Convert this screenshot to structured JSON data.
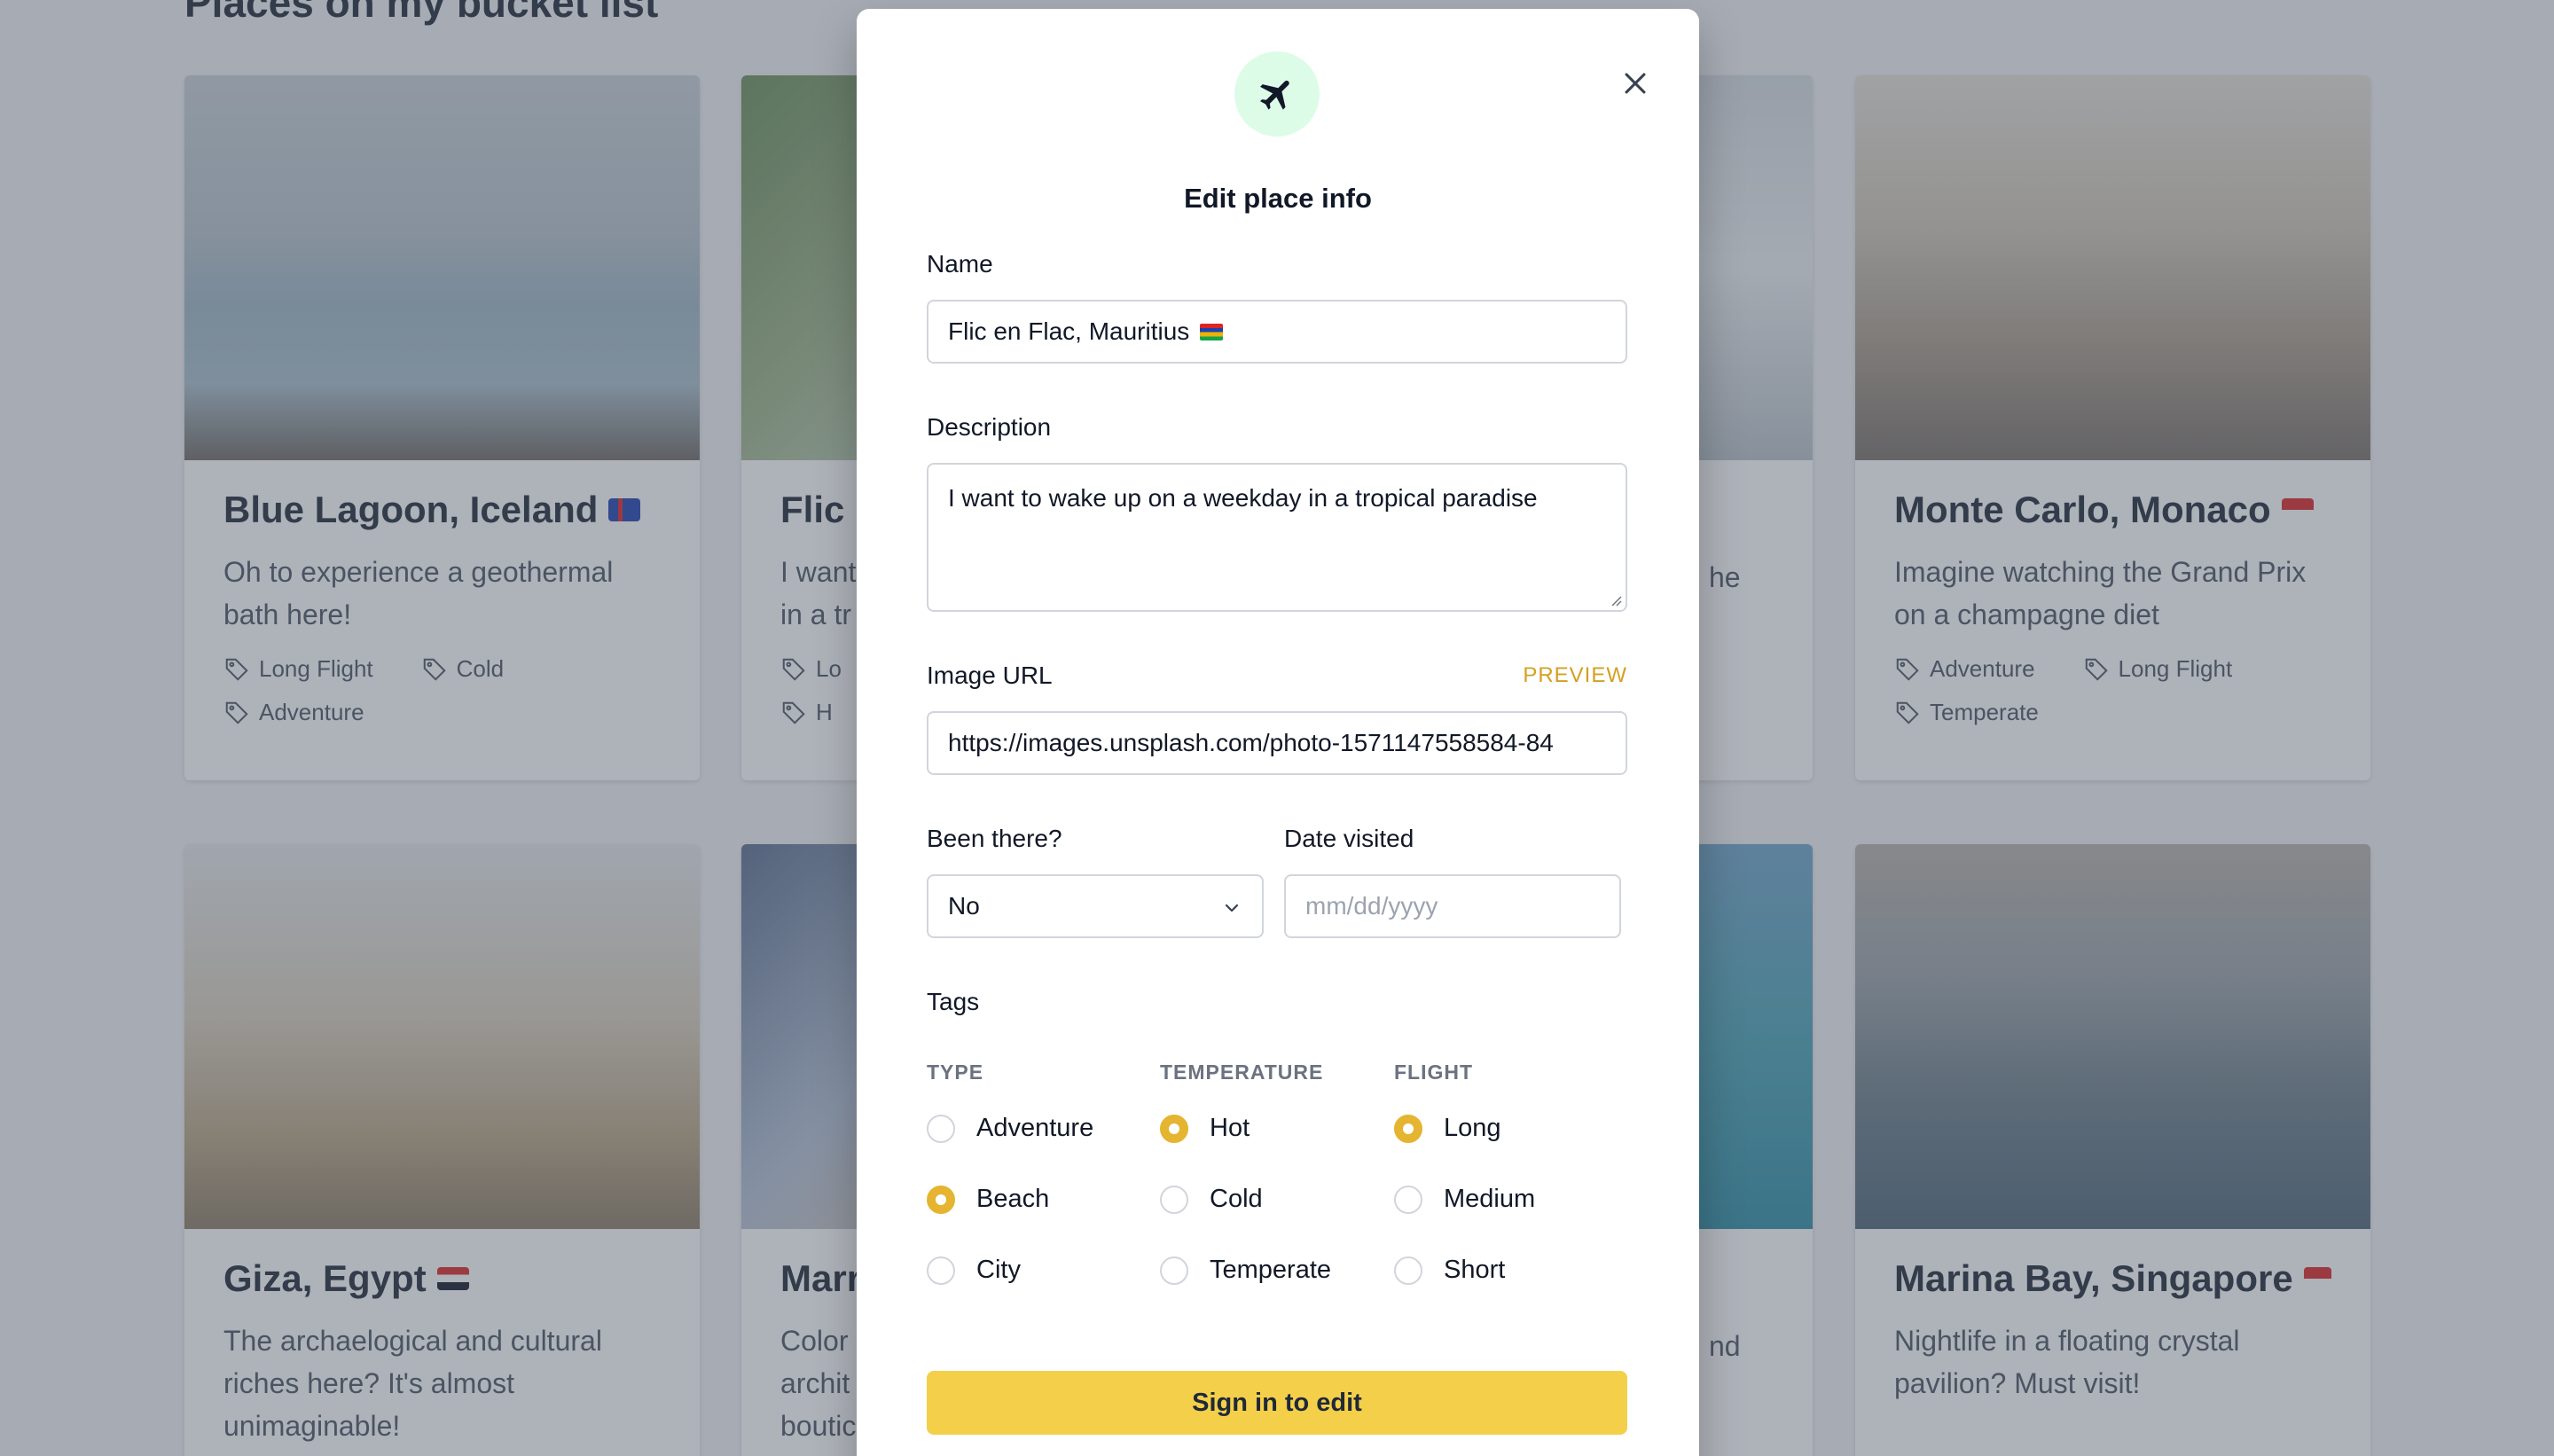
{
  "page": {
    "heading": "Places on my bucket list"
  },
  "cards": [
    {
      "title": "Blue Lagoon, Iceland",
      "description": "Oh to experience a geothermal bath here!",
      "tags": [
        "Long Flight",
        "Cold",
        "Adventure"
      ],
      "flag_colors": [
        "#1e40af",
        "#dc2626"
      ]
    },
    {
      "title": "Flic",
      "description": "I want",
      "description2": "in a tr",
      "tags": [
        "Lo",
        "H"
      ],
      "flag_colors": [
        "#16a34a",
        "#eab308"
      ]
    },
    {
      "title": "",
      "description": "he",
      "tags": [],
      "flag_colors": []
    },
    {
      "title": "Monte Carlo, Monaco",
      "description": "Imagine watching the Grand Prix on a champagne diet",
      "tags": [
        "Adventure",
        "Long Flight",
        "Temperate"
      ],
      "flag_colors": [
        "#dc2626",
        "#ffffff"
      ]
    },
    {
      "title": "Giza, Egypt",
      "description": "The archaelogical and cultural riches here? It's almost unimaginable!",
      "tags": [],
      "flag_colors": [
        "#dc2626",
        "#111827"
      ]
    },
    {
      "title": "Marr",
      "description": "Color",
      "description2": "archit",
      "description3": "boutic",
      "tags": [],
      "flag_colors": []
    },
    {
      "title": "",
      "description": "nd",
      "tags": [],
      "flag_colors": []
    },
    {
      "title": "Marina Bay, Singapore",
      "description": "Nightlife in a floating crystal pavilion? Must visit!",
      "tags": [],
      "flag_colors": [
        "#dc2626",
        "#ffffff"
      ]
    }
  ],
  "modal": {
    "icon": "airplane-icon",
    "title": "Edit place info",
    "close_icon": "close-icon",
    "name": {
      "label": "Name",
      "value": "Flic en Flac, Mauritius"
    },
    "description": {
      "label": "Description",
      "value": "I want to wake up on a weekday in a tropical paradise"
    },
    "image_url": {
      "label": "Image URL",
      "preview": "PREVIEW",
      "value": "https://images.unsplash.com/photo-1571147558584-84"
    },
    "been_there": {
      "label": "Been there?",
      "value": "No"
    },
    "date_visited": {
      "label": "Date visited",
      "placeholder": "mm/dd/yyyy"
    },
    "tags": {
      "label": "Tags",
      "groups": [
        {
          "header": "TYPE",
          "options": [
            {
              "label": "Adventure",
              "selected": false
            },
            {
              "label": "Beach",
              "selected": true
            },
            {
              "label": "City",
              "selected": false
            }
          ]
        },
        {
          "header": "TEMPERATURE",
          "options": [
            {
              "label": "Hot",
              "selected": true
            },
            {
              "label": "Cold",
              "selected": false
            },
            {
              "label": "Temperate",
              "selected": false
            }
          ]
        },
        {
          "header": "FLIGHT",
          "options": [
            {
              "label": "Long",
              "selected": true
            },
            {
              "label": "Medium",
              "selected": false
            },
            {
              "label": "Short",
              "selected": false
            }
          ]
        }
      ]
    },
    "submit_label": "Sign in to edit"
  },
  "colors": {
    "accent": "#e5b430",
    "button": "#f4cf4a",
    "icon_bg": "#dcfce7"
  }
}
